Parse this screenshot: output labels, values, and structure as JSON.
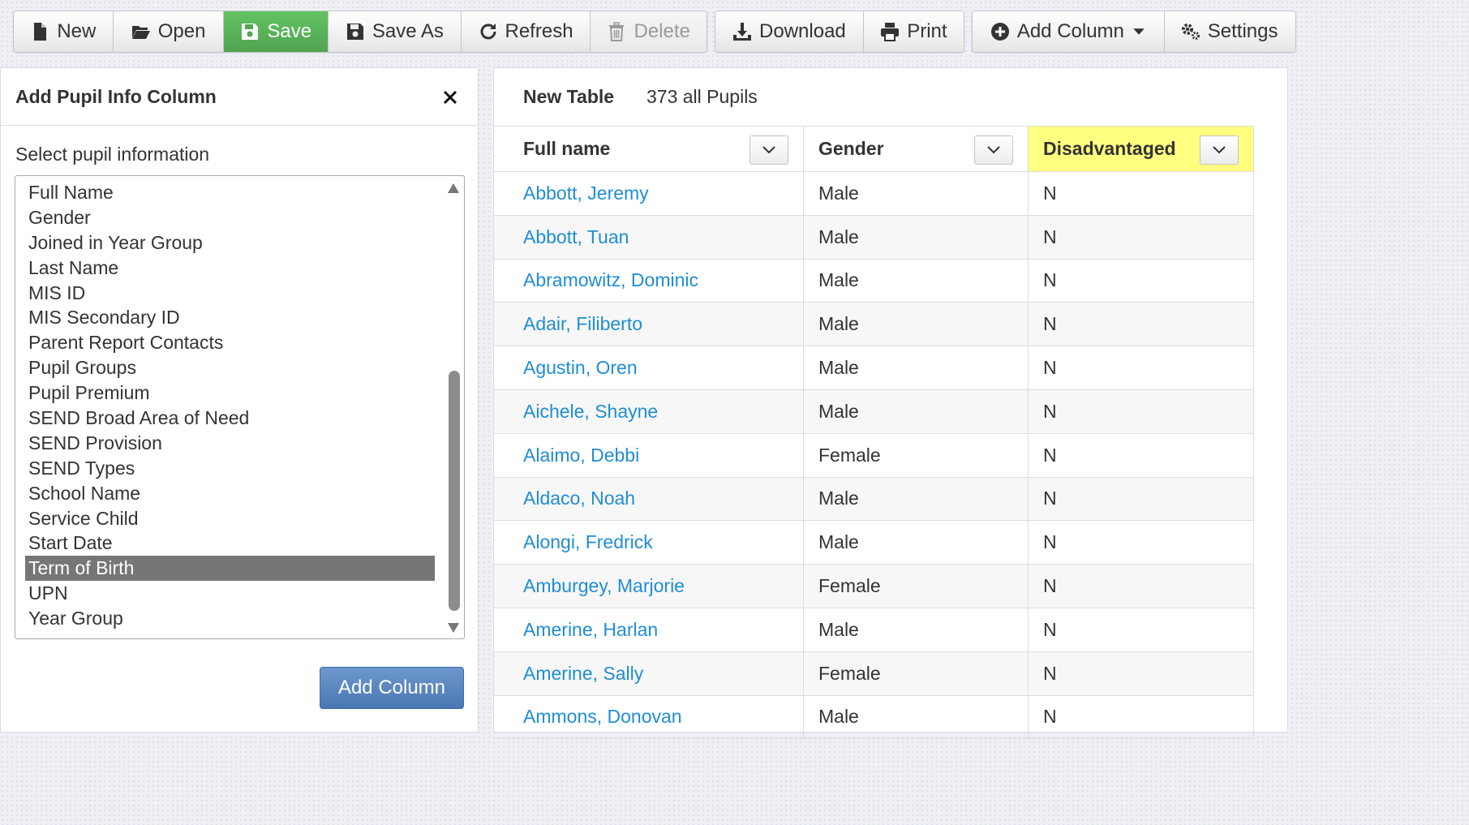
{
  "toolbar": {
    "new": "New",
    "open": "Open",
    "save": "Save",
    "save_as": "Save As",
    "refresh": "Refresh",
    "delete": "Delete",
    "download": "Download",
    "print": "Print",
    "add_column": "Add Column",
    "settings": "Settings"
  },
  "left_panel": {
    "title": "Add Pupil Info Column",
    "select_label": "Select pupil information",
    "options": [
      "Full Name",
      "Gender",
      "Joined in Year Group",
      "Last Name",
      "MIS ID",
      "MIS Secondary ID",
      "Parent Report Contacts",
      "Pupil Groups",
      "Pupil Premium",
      "SEND Broad Area of Need",
      "SEND Provision",
      "SEND Types",
      "School Name",
      "Service Child",
      "Start Date",
      "Term of Birth",
      "UPN",
      "Year Group"
    ],
    "selected_option": "Term of Birth",
    "add_button": "Add Column"
  },
  "table": {
    "title": "New Table",
    "count_text": "373 all Pupils",
    "columns": [
      "Full name",
      "Gender",
      "Disadvantaged"
    ],
    "rows": [
      [
        "Abbott, Jeremy",
        "Male",
        "N"
      ],
      [
        "Abbott, Tuan",
        "Male",
        "N"
      ],
      [
        "Abramowitz, Dominic",
        "Male",
        "N"
      ],
      [
        "Adair, Filiberto",
        "Male",
        "N"
      ],
      [
        "Agustin, Oren",
        "Male",
        "N"
      ],
      [
        "Aichele, Shayne",
        "Male",
        "N"
      ],
      [
        "Alaimo, Debbi",
        "Female",
        "N"
      ],
      [
        "Aldaco, Noah",
        "Male",
        "N"
      ],
      [
        "Alongi, Fredrick",
        "Male",
        "N"
      ],
      [
        "Amburgey, Marjorie",
        "Female",
        "N"
      ],
      [
        "Amerine, Harlan",
        "Male",
        "N"
      ],
      [
        "Amerine, Sally",
        "Female",
        "N"
      ],
      [
        "Ammons, Donovan",
        "Male",
        "N"
      ]
    ]
  },
  "colors": {
    "save_green": "#5cb85c",
    "link_blue": "#1f8dd6",
    "highlight_yellow": "#ffff80",
    "primary_blue": "#4a77b3",
    "selected_gray": "#767676"
  }
}
